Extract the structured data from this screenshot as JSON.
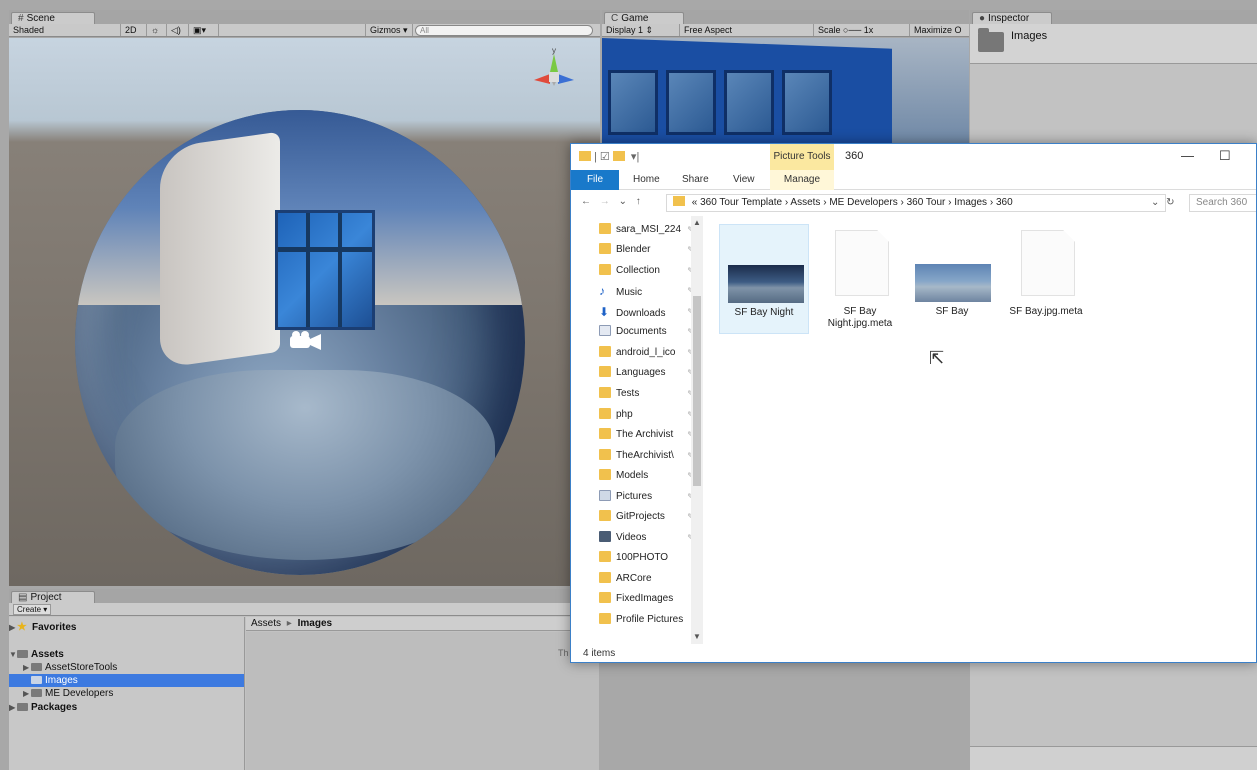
{
  "scene": {
    "tab": "Scene",
    "toolbar": {
      "shading": "Shaded",
      "mode_2d": "2D",
      "gizmos": "Gizmos",
      "search_placeholder": "All"
    }
  },
  "game": {
    "tab": "Game",
    "toolbar": {
      "display": "Display 1",
      "aspect": "Free Aspect",
      "scale_label": "Scale",
      "scale_value": "1x",
      "maximize": "Maximize O"
    }
  },
  "inspector": {
    "tab": "Inspector",
    "title": "Images"
  },
  "project": {
    "tab": "Project",
    "create": "Create",
    "tree": [
      {
        "label": "Favorites"
      },
      {
        "label": "Assets"
      },
      {
        "label": "AssetStoreTools"
      },
      {
        "label": "Images"
      },
      {
        "label": "ME Developers"
      },
      {
        "label": "Packages"
      }
    ],
    "breadcrumb_root": "Assets",
    "breadcrumb_sep": "▸",
    "breadcrumb_current": "Images",
    "partial_text": "Th"
  },
  "explorer": {
    "title": "360",
    "picture_tools": "Picture Tools",
    "ribbon": {
      "file": "File",
      "home": "Home",
      "share": "Share",
      "view": "View",
      "manage": "Manage"
    },
    "address": {
      "prefix": "«",
      "parts": [
        "360 Tour Template",
        "Assets",
        "ME Developers",
        "360 Tour",
        "Images",
        "360"
      ],
      "sep": "›"
    },
    "search_placeholder": "Search 360",
    "nav_items": [
      "sara_MSI_224",
      "Blender",
      "Collection",
      "Music",
      "Downloads",
      "Documents",
      "android_l_ico",
      "Languages",
      "Tests",
      "php",
      "The Archivist",
      "TheArchivist\\",
      "Models",
      "Pictures",
      "GitProjects",
      "Videos",
      "100PHOTO",
      "ARCore",
      "FixedImages",
      "Profile Pictures"
    ],
    "files": [
      {
        "name": "SF Bay Night"
      },
      {
        "name": "SF Bay Night.jpg.meta"
      },
      {
        "name": "SF Bay"
      },
      {
        "name": "SF Bay.jpg.meta"
      }
    ],
    "status": "4 items",
    "icons": {
      "back": "←",
      "forward": "→",
      "recent": "⌄",
      "up": "↑",
      "dropdown": "⌄",
      "refresh": "↻",
      "minimize": "—",
      "maximize": "☐"
    }
  }
}
